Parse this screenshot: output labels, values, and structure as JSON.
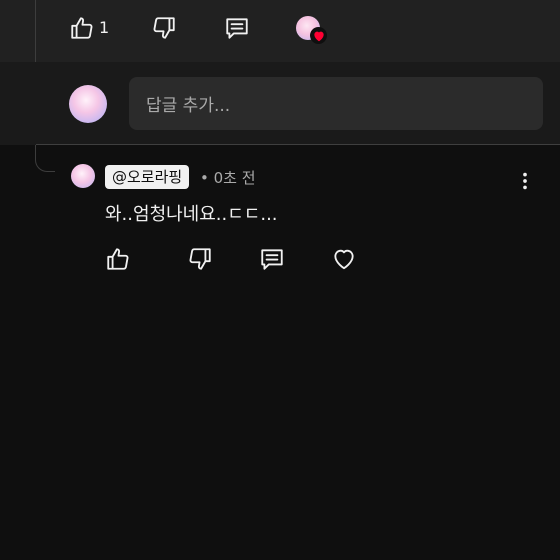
{
  "parent_comment": {
    "like_count": "1",
    "icons": [
      "thumbs-up-icon",
      "thumbs-down-icon",
      "reply-icon",
      "creator-heart-icon"
    ]
  },
  "reply_box": {
    "placeholder": "답글 추가..."
  },
  "reply": {
    "author": "@오로라핑",
    "time": "• 0초 전",
    "text": "와..엄청나네요..ㄷㄷ...",
    "icons": [
      "thumbs-up-icon",
      "thumbs-down-icon",
      "reply-icon",
      "heart-outline-icon",
      "more-vert-icon"
    ]
  },
  "colors": {
    "background": "#0f0f0f",
    "top_band": "#212121",
    "input_bg": "#2b2b2b",
    "heart_red": "#ff0033",
    "chip_bg": "#f1f1f1"
  }
}
